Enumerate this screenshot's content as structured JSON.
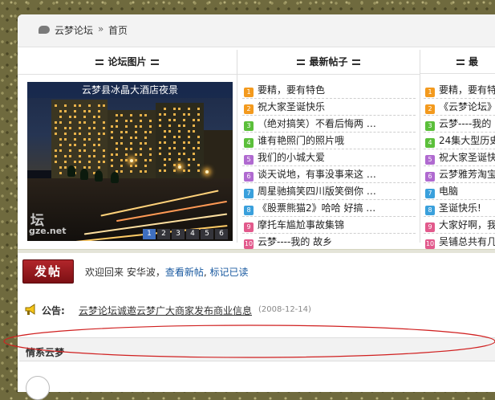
{
  "breadcrumb": {
    "home": "云梦论坛",
    "separator": "»",
    "current": "首页"
  },
  "columns": {
    "photos": "论坛图片",
    "latest": "最新帖子",
    "third": "最"
  },
  "slideshow": {
    "caption": "云梦县冰晶大酒店夜景",
    "watermark": "坛",
    "watermark2": "gze.net",
    "pages": [
      "1",
      "2",
      "3",
      "4",
      "5",
      "6"
    ],
    "active_page": "1"
  },
  "latest_posts": [
    {
      "num": "1",
      "color": "#f39a1e",
      "title": "要精，要有特色"
    },
    {
      "num": "2",
      "color": "#f39a1e",
      "title": "祝大家圣诞快乐"
    },
    {
      "num": "3",
      "color": "#5bbf3a",
      "title": "（绝对搞笑）不看后悔两  …"
    },
    {
      "num": "4",
      "color": "#5bbf3a",
      "title": "谁有艳照门的照片哦"
    },
    {
      "num": "5",
      "color": "#b06ad0",
      "title": "我们的小城大爱"
    },
    {
      "num": "6",
      "color": "#b06ad0",
      "title": "谈天说地，有事没事来这  …"
    },
    {
      "num": "7",
      "color": "#3aa0dc",
      "title": "周星驰搞笑四川版笑倒你  …"
    },
    {
      "num": "8",
      "color": "#3aa0dc",
      "title": "《股票熊猫2》哈哈 好搞  …"
    },
    {
      "num": "9",
      "color": "#e25a8c",
      "title": "摩托车尴尬事故集锦"
    },
    {
      "num": "10",
      "color": "#e25a8c",
      "title": "云梦----我的  故乡"
    }
  ],
  "third_posts": [
    {
      "num": "1",
      "color": "#f39a1e",
      "title": "要精，要有特色"
    },
    {
      "num": "2",
      "color": "#f39a1e",
      "title": "《云梦论坛》"
    },
    {
      "num": "3",
      "color": "#5bbf3a",
      "title": "云梦----我的"
    },
    {
      "num": "4",
      "color": "#5bbf3a",
      "title": "24集大型历史"
    },
    {
      "num": "5",
      "color": "#b06ad0",
      "title": "祝大家圣诞快"
    },
    {
      "num": "6",
      "color": "#b06ad0",
      "title": "云梦雅芳淘宝"
    },
    {
      "num": "7",
      "color": "#3aa0dc",
      "title": "电脑"
    },
    {
      "num": "8",
      "color": "#3aa0dc",
      "title": "圣诞快乐!"
    },
    {
      "num": "9",
      "color": "#e25a8c",
      "title": "大家好啊，我"
    },
    {
      "num": "10",
      "color": "#e25a8c",
      "title": "吴铺总共有几"
    }
  ],
  "post_button": "发帖",
  "welcome": {
    "text": "欢迎回来 安华波，",
    "new_posts": "查看新帖",
    "comma": ", ",
    "mark_read": "标记已读"
  },
  "announcement": {
    "label": "公告:",
    "text": "云梦论坛诚邀云梦广大商家发布商业信息",
    "date": "(2008-12-14)"
  },
  "section": {
    "title": "情系云梦"
  }
}
